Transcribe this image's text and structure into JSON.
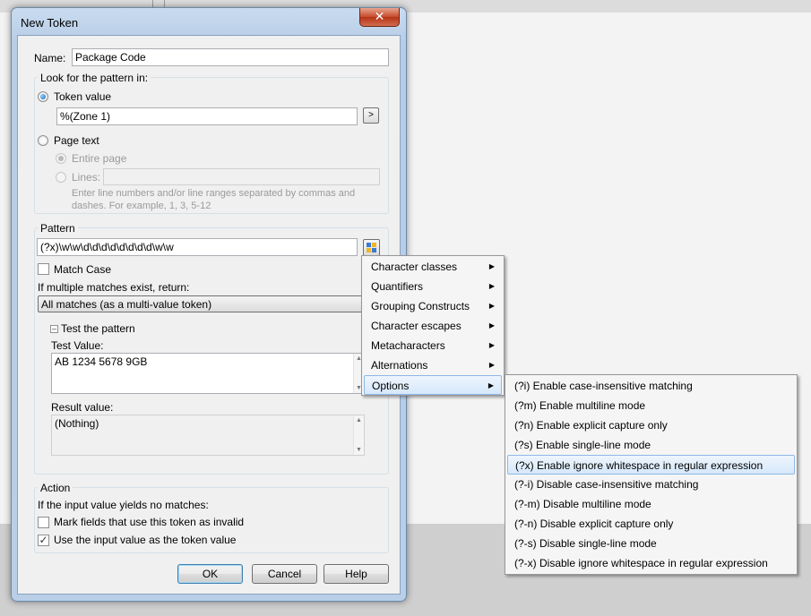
{
  "window": {
    "title": "New Token",
    "close_glyph": "✕"
  },
  "name_field": {
    "label": "Name:",
    "value": "Package Code"
  },
  "look_for": {
    "group_title": "Look for the pattern in:",
    "token_value_label": "Token value",
    "token_value": "%(Zone 1)",
    "token_button": ">",
    "page_text_label": "Page text",
    "entire_page_label": "Entire page",
    "lines_label": "Lines:",
    "lines_value": "",
    "hint_line1": "Enter line numbers and/or line ranges separated by commas and",
    "hint_line2": "dashes.  For example, 1, 3, 5-12"
  },
  "pattern": {
    "group_title": "Pattern",
    "value": "(?x)\\w\\w\\d\\d\\d\\d\\d\\d\\d\\d\\w\\w",
    "match_case_label": "Match Case",
    "multiple_label": "If multiple matches exist, return:",
    "multiple_value": "All matches (as a multi-value token)",
    "test_header": "Test the pattern",
    "test_value_label": "Test Value:",
    "test_value": "AB 1234 5678 9GB",
    "result_label": "Result value:",
    "result_value": "(Nothing)"
  },
  "action": {
    "group_title": "Action",
    "no_match_label": "If the input value yields no matches:",
    "mark_invalid_label": "Mark fields that use this token as invalid",
    "use_input_label": "Use the input value as the token value"
  },
  "buttons": {
    "ok": "OK",
    "cancel": "Cancel",
    "help": "Help"
  },
  "menu": {
    "items": [
      {
        "label": "Character classes"
      },
      {
        "label": "Quantifiers"
      },
      {
        "label": "Grouping Constructs"
      },
      {
        "label": "Character escapes"
      },
      {
        "label": "Metacharacters"
      },
      {
        "label": "Alternations"
      },
      {
        "label": "Options"
      }
    ]
  },
  "options_submenu": {
    "items": [
      {
        "label": "(?i)  Enable case-insensitive matching"
      },
      {
        "label": "(?m)  Enable multiline mode"
      },
      {
        "label": "(?n)  Enable explicit capture only"
      },
      {
        "label": "(?s)  Enable single-line mode"
      },
      {
        "label": "(?x)  Enable ignore whitespace in regular expression"
      },
      {
        "label": "(?-i)  Disable case-insensitive matching"
      },
      {
        "label": "(?-m)  Disable multiline mode"
      },
      {
        "label": "(?-n)  Disable explicit capture only"
      },
      {
        "label": "(?-s)  Disable single-line mode"
      },
      {
        "label": "(?-x)  Disable ignore whitespace in regular expression"
      }
    ]
  },
  "colors": {
    "titlebar": "#b9cfe7",
    "close": "#c74a2c",
    "menu_highlight": "#d6e8fb"
  }
}
